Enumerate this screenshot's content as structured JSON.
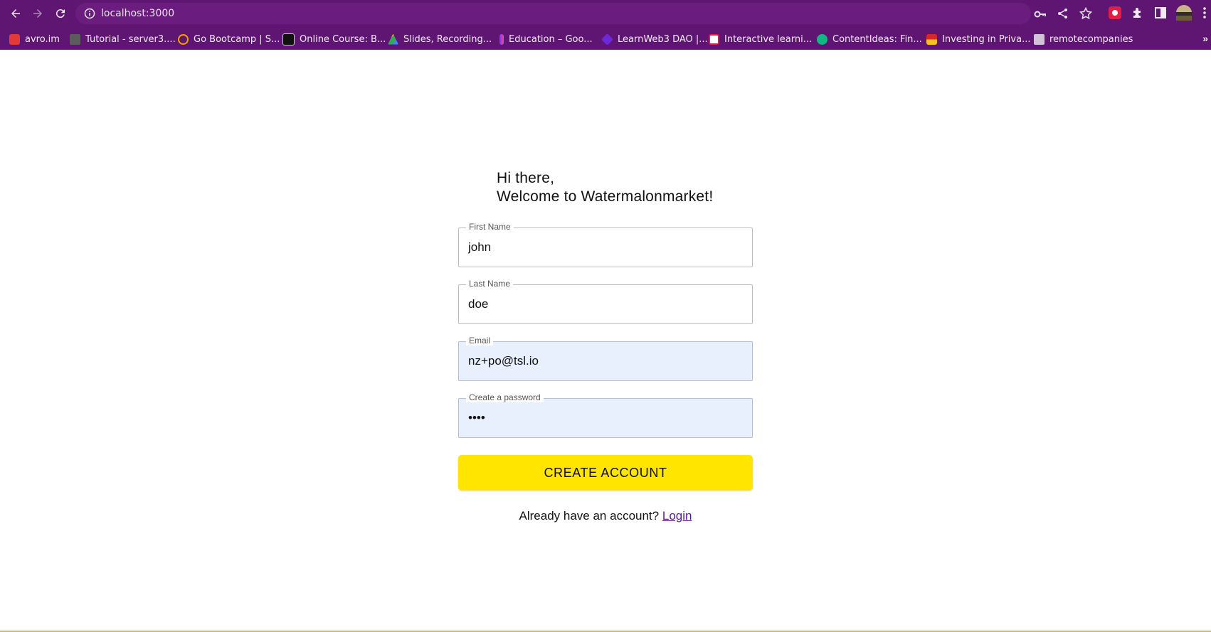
{
  "browser": {
    "url": "localhost:3000",
    "bookmarks": [
      {
        "label": "avro.im",
        "color": "#e53935"
      },
      {
        "label": "Tutorial - server3....",
        "color": "#5c5c5c"
      },
      {
        "label": "Go Bootcamp | S...",
        "color": "#f59e0b"
      },
      {
        "label": "Online Course: B...",
        "color": "#111111"
      },
      {
        "label": "Slides, Recording...",
        "color": "#34a853"
      },
      {
        "label": "Education – Goo...",
        "color": "#7c3aed"
      },
      {
        "label": "LearnWeb3 DAO |...",
        "color": "#6d28d9"
      },
      {
        "label": "Interactive learni...",
        "color": "#ffffff"
      },
      {
        "label": "ContentIdeas: Fin...",
        "color": "#10b981"
      },
      {
        "label": "Investing in Priva...",
        "color": "#dc2626"
      },
      {
        "label": "remotecompanies",
        "color": "#d1c4d8"
      }
    ],
    "more_label": "»"
  },
  "page": {
    "greeting_line1": "Hi there,",
    "greeting_line2": "Welcome to Watermalonmarket!",
    "fields": [
      {
        "label": "First Name",
        "value": "john",
        "type": "text"
      },
      {
        "label": "Last Name",
        "value": "doe",
        "type": "text"
      },
      {
        "label": "Email",
        "value": "nz+po@tsl.io",
        "type": "email"
      },
      {
        "label": "Create a password",
        "value": "••••",
        "type": "password"
      }
    ],
    "submit_label": "CREATE ACCOUNT",
    "login_prompt": "Already have an account?",
    "login_link": "Login"
  },
  "colors": {
    "chrome": "#5f1672",
    "button": "#ffe500",
    "autofill": "#e8f0fe"
  }
}
